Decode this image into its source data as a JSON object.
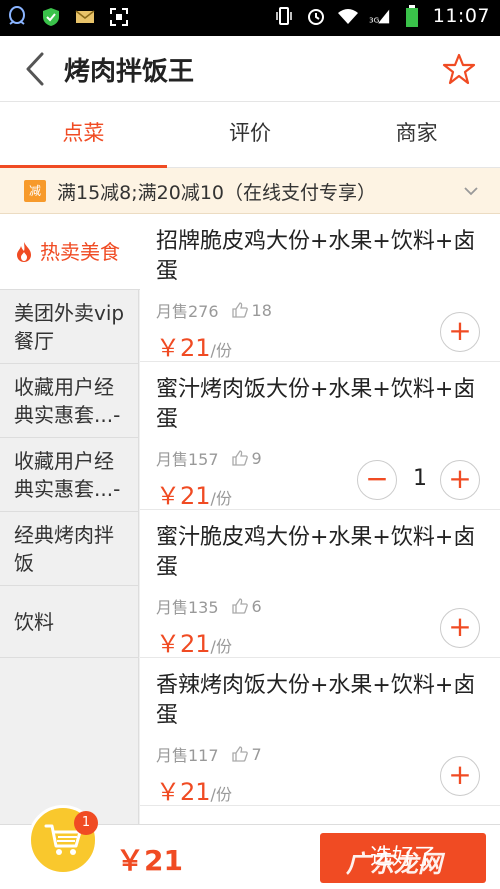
{
  "status_bar": {
    "time": "11:07",
    "network": "3G"
  },
  "header": {
    "title": "烤肉拌饭王"
  },
  "tabs": [
    {
      "label": "点菜",
      "active": true
    },
    {
      "label": "评价",
      "active": false
    },
    {
      "label": "商家",
      "active": false
    }
  ],
  "promo": {
    "badge": "减",
    "text": "满15减8;满20减10（在线支付专享）"
  },
  "sidebar": {
    "categories": [
      {
        "label": "热卖美食",
        "active": true,
        "icon": "fire-icon"
      },
      {
        "label": "美团外卖vip餐厅"
      },
      {
        "label": "收藏用户经典实惠套...-"
      },
      {
        "label": "收藏用户经典实惠套...-"
      },
      {
        "label": "经典烤肉拌饭"
      },
      {
        "label": "饮料"
      }
    ]
  },
  "menu": {
    "items": [
      {
        "name": "招牌脆皮鸡大份+水果+饮料+卤蛋",
        "sales": "月售276",
        "likes": "18",
        "price": "￥21",
        "unit": "/份",
        "quantity": null
      },
      {
        "name": "蜜汁烤肉饭大份+水果+饮料+卤蛋",
        "sales": "月售157",
        "likes": "9",
        "price": "￥21",
        "unit": "/份",
        "quantity": "1"
      },
      {
        "name": "蜜汁脆皮鸡大份+水果+饮料+卤蛋",
        "sales": "月售135",
        "likes": "6",
        "price": "￥21",
        "unit": "/份",
        "quantity": null
      },
      {
        "name": "香辣烤肉饭大份+水果+饮料+卤蛋",
        "sales": "月售117",
        "likes": "7",
        "price": "￥21",
        "unit": "/份",
        "quantity": null
      }
    ],
    "add_symbol": "+",
    "minus_symbol": "−"
  },
  "cart": {
    "badge_count": "1",
    "total": "￥21",
    "checkout_label": "选好了"
  },
  "watermark": {
    "text": "广东龙网"
  },
  "colors": {
    "accent": "#f04b23",
    "cart_yellow": "#f9c82d",
    "promo_bg": "#fdf3e3"
  }
}
